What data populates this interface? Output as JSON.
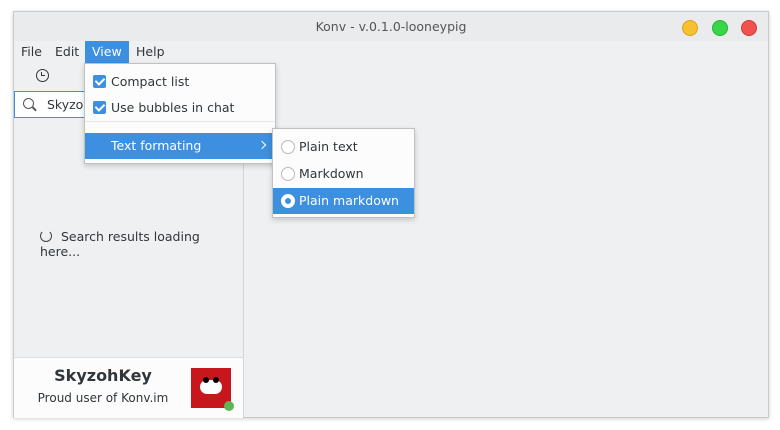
{
  "window": {
    "title": "Konv - v.0.1.0-looneypig"
  },
  "menubar": {
    "file": "File",
    "edit": "Edit",
    "view": "View",
    "help": "Help"
  },
  "sidebar": {
    "search_value": "Skyzoh",
    "loading_text": "Search results loading here...",
    "profile": {
      "name": "SkyzohKey",
      "status": "Proud user of Konv.im"
    }
  },
  "view_menu": {
    "items": [
      {
        "label": "Compact list",
        "checked": true
      },
      {
        "label": "Use bubbles in chat",
        "checked": true
      },
      {
        "label": "Text formating",
        "submenu": true
      }
    ]
  },
  "format_menu": {
    "items": [
      {
        "label": "Plain text",
        "selected": false
      },
      {
        "label": "Markdown",
        "selected": false
      },
      {
        "label": "Plain markdown",
        "selected": true
      }
    ]
  },
  "colors": {
    "accent": "#3d8fe0",
    "online": "#5eb553",
    "avatar_bg": "#c8161d"
  }
}
